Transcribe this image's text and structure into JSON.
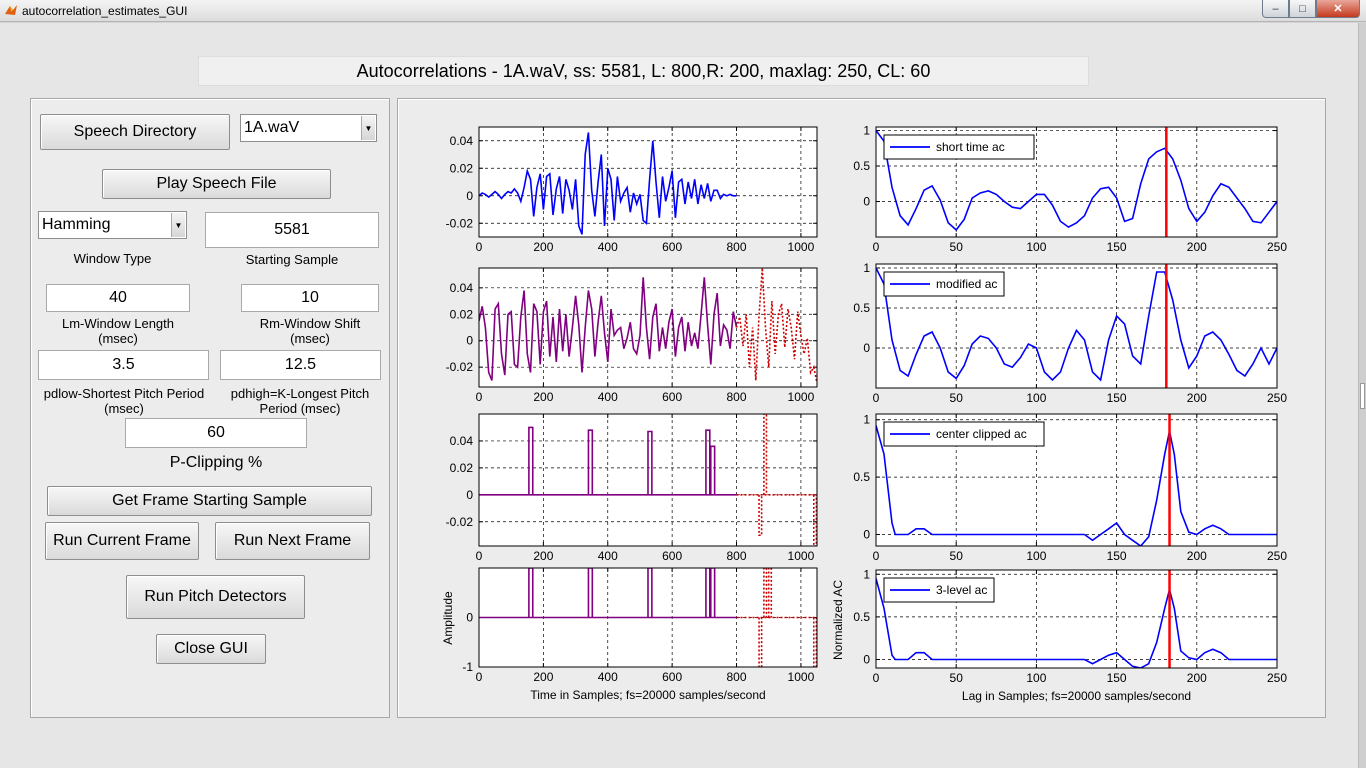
{
  "window": {
    "title": "autocorrelation_estimates_GUI",
    "minimize": "–",
    "maximize": "□",
    "close": "✕"
  },
  "heading": "Autocorrelations - 1A.waV, ss: 5581, L: 800,R: 200, maxlag: 250, CL: 60",
  "controls": {
    "speech_directory": "Speech Directory",
    "file_select": "1A.waV",
    "play_speech": "Play Speech File",
    "window_type_value": "Hamming",
    "window_type_label": "Window Type",
    "starting_sample_value": "5581",
    "starting_sample_label": "Starting Sample",
    "lm_value": "40",
    "lm_label_1": "Lm-Window Length",
    "lm_label_2": "(msec)",
    "rm_value": "10",
    "rm_label_1": "Rm-Window Shift",
    "rm_label_2": "(msec)",
    "pdlow_value": "3.5",
    "pdlow_label_1": "pdlow-Shortest Pitch Period",
    "pdlow_label_2": "(msec)",
    "pdhigh_value": "12.5",
    "pdhigh_label_1": "pdhigh=K-Longest Pitch",
    "pdhigh_label_2": "Period (msec)",
    "pclip_value": "60",
    "pclip_label": "P-Clipping %",
    "get_frame": "Get Frame Starting Sample",
    "run_current": "Run Current Frame",
    "run_next": "Run Next Frame",
    "run_pitch": "Run Pitch Detectors",
    "close_gui": "Close GUI"
  },
  "colors": {
    "signal": "#0000ff",
    "overlay": "#cc0000",
    "clipped": "#800080",
    "pitch_marker": "#ff0000"
  },
  "chart_data": [
    {
      "type": "line",
      "x_ticks": [
        0,
        200,
        400,
        600,
        800,
        1000
      ],
      "xlim": [
        0,
        1050
      ],
      "y_ticks": [
        -0.02,
        0,
        0.02,
        0.04
      ],
      "y_tick_labels": [
        "-0.02",
        "0",
        "0.02",
        "0.04"
      ],
      "ylim": [
        -0.03,
        0.05
      ],
      "grid": true,
      "series": [
        {
          "kind": "speech",
          "x": [
            0,
            10,
            20,
            30,
            40,
            50,
            60,
            70,
            80,
            90,
            100,
            110,
            120,
            130,
            140,
            150,
            160,
            170,
            180,
            190,
            200,
            210,
            220,
            230,
            240,
            250,
            260,
            270,
            280,
            290,
            300,
            310,
            320,
            330,
            340,
            350,
            360,
            370,
            380,
            390,
            400,
            410,
            420,
            430,
            440,
            450,
            460,
            470,
            480,
            490,
            500,
            510,
            520,
            530,
            540,
            550,
            560,
            570,
            580,
            590,
            600,
            610,
            620,
            630,
            640,
            650,
            660,
            670,
            680,
            690,
            700,
            710,
            720,
            730,
            740,
            750,
            760,
            770,
            780,
            790,
            800
          ],
          "y": [
            0,
            0.002,
            0.001,
            -0.001,
            0.001,
            0.003,
            0.001,
            -0.002,
            0.001,
            0.003,
            0.002,
            0.005,
            0.002,
            -0.004,
            0.006,
            0.018,
            0.012,
            -0.015,
            0.006,
            0.016,
            -0.01,
            0.014,
            0.016,
            -0.014,
            0.005,
            0.014,
            -0.013,
            0.012,
            0.004,
            -0.01,
            0.012,
            -0.022,
            -0.028,
            0.03,
            0.046,
            0.004,
            -0.015,
            0.01,
            0.03,
            -0.022,
            0.02,
            0.012,
            -0.018,
            0.014,
            -0.004,
            0.002,
            0.006,
            -0.012,
            0.002,
            -0.006,
            0.001,
            -0.018,
            -0.02,
            0.012,
            0.04,
            0.01,
            -0.016,
            0.014,
            -0.004,
            0.006,
            0.018,
            -0.016,
            0.01,
            0.012,
            -0.006,
            0.01,
            -0.002,
            0.012,
            -0.006,
            0.008,
            -0.002,
            0.009,
            -0.004,
            0.004,
            0.004,
            -0.002,
            0.001,
            0,
            0.001,
            0,
            0
          ]
        }
      ]
    },
    {
      "type": "line",
      "x_ticks": [
        0,
        200,
        400,
        600,
        800,
        1000
      ],
      "xlim": [
        0,
        1050
      ],
      "y_ticks": [
        -0.02,
        0,
        0.02,
        0.04
      ],
      "y_tick_labels": [
        "-0.02",
        "0",
        "0.02",
        "0.04"
      ],
      "ylim": [
        -0.035,
        0.055
      ],
      "grid": true,
      "series": [
        {
          "kind": "clipped_window",
          "x": [
            0,
            10,
            20,
            30,
            40,
            50,
            60,
            70,
            80,
            90,
            100,
            110,
            120,
            130,
            140,
            150,
            160,
            170,
            180,
            190,
            200,
            210,
            220,
            230,
            240,
            250,
            260,
            270,
            280,
            290,
            300,
            310,
            320,
            330,
            340,
            350,
            360,
            370,
            380,
            390,
            400,
            410,
            420,
            430,
            440,
            450,
            460,
            470,
            480,
            490,
            500,
            510,
            520,
            530,
            540,
            550,
            560,
            570,
            580,
            590,
            600,
            610,
            620,
            630,
            640,
            650,
            660,
            670,
            680,
            690,
            700,
            710,
            720,
            730,
            740,
            750,
            760,
            770,
            780,
            790,
            800
          ],
          "y": [
            0.015,
            0.026,
            0.01,
            -0.024,
            -0.03,
            0.024,
            0.028,
            -0.01,
            -0.026,
            0.02,
            0.022,
            -0.018,
            -0.02,
            0.018,
            0.038,
            -0.01,
            -0.024,
            0.028,
            0.022,
            -0.018,
            0.022,
            0.03,
            -0.012,
            0.018,
            -0.016,
            0.024,
            -0.008,
            0.02,
            -0.012,
            0.01,
            0.034,
            0.012,
            -0.024,
            0.01,
            0.038,
            0.024,
            -0.012,
            0.014,
            0.034,
            0.006,
            -0.016,
            0.024,
            0.004,
            0.008,
            0.01,
            -0.006,
            0.002,
            0.014,
            -0.006,
            -0.01,
            0.004,
            0.048,
            0.01,
            -0.014,
            0.018,
            0.028,
            -0.008,
            0.01,
            -0.006,
            0.014,
            0.024,
            -0.012,
            0.01,
            0.018,
            -0.008,
            0.014,
            -0.004,
            0.006,
            -0.006,
            0.02,
            0.048,
            0.012,
            -0.018,
            0.02,
            0.036,
            -0.004,
            0.012,
            0.008,
            -0.006,
            0.022,
            0.01
          ]
        },
        {
          "kind": "lookahead",
          "x": [
            800,
            810,
            820,
            830,
            840,
            850,
            860,
            870,
            880,
            890,
            900,
            910,
            920,
            930,
            940,
            950,
            960,
            970,
            980,
            990,
            1000,
            1010,
            1020,
            1030,
            1040,
            1050
          ],
          "y": [
            0.01,
            0.018,
            -0.004,
            0.02,
            -0.02,
            0.01,
            -0.03,
            0.02,
            0.055,
            0.01,
            -0.02,
            0.03,
            -0.01,
            0.02,
            0.028,
            -0.005,
            0.024,
            0.01,
            -0.014,
            0.022,
            0.004,
            -0.01,
            0.002,
            -0.024,
            -0.02,
            -0.032
          ]
        }
      ]
    },
    {
      "type": "line",
      "x_ticks": [
        0,
        200,
        400,
        600,
        800,
        1000
      ],
      "xlim": [
        0,
        1050
      ],
      "y_ticks": [
        -0.02,
        0,
        0.02,
        0.04
      ],
      "y_tick_labels": [
        "-0.02",
        "0",
        "0.02",
        "0.04"
      ],
      "ylim": [
        -0.038,
        0.06
      ],
      "grid": true,
      "pulses": [
        {
          "x": 155,
          "h": 0.05
        },
        {
          "x": 340,
          "h": 0.048
        },
        {
          "x": 525,
          "h": 0.047
        },
        {
          "x": 705,
          "h": 0.048
        },
        {
          "x": 720,
          "h": 0.036
        }
      ],
      "lookahead_pulses": [
        {
          "x": 870,
          "h": -0.03
        },
        {
          "x": 885,
          "h": 0.06
        },
        {
          "x": 1040,
          "h": -0.038
        }
      ]
    },
    {
      "type": "line",
      "ylabel": "Amplitude",
      "xlabel": "Time in Samples; fs=20000 samples/second",
      "x_ticks": [
        0,
        200,
        400,
        600,
        800,
        1000
      ],
      "xlim": [
        0,
        1050
      ],
      "y_ticks": [
        -1,
        0
      ],
      "y_tick_labels": [
        "-1",
        "0"
      ],
      "ylim": [
        -1,
        1
      ],
      "grid": true,
      "pulses": [
        {
          "x": 155,
          "h": 1
        },
        {
          "x": 340,
          "h": 1
        },
        {
          "x": 525,
          "h": 1
        },
        {
          "x": 705,
          "h": 1
        },
        {
          "x": 720,
          "h": 1
        }
      ],
      "lookahead_pulses": [
        {
          "x": 870,
          "h": -1
        },
        {
          "x": 885,
          "h": 1
        },
        {
          "x": 900,
          "h": 1
        },
        {
          "x": 1040,
          "h": -1
        }
      ]
    },
    {
      "type": "line",
      "x_ticks": [
        0,
        50,
        100,
        150,
        200,
        250
      ],
      "xlim": [
        0,
        250
      ],
      "y_ticks": [
        0,
        0.5,
        1
      ],
      "y_tick_labels": [
        "0",
        "0.5",
        "1"
      ],
      "ylim": [
        -0.5,
        1.05
      ],
      "grid": true,
      "legend": "short time ac",
      "pitch_lag": 181,
      "series": [
        {
          "x": [
            0,
            5,
            10,
            15,
            20,
            25,
            30,
            35,
            40,
            45,
            50,
            55,
            60,
            65,
            70,
            75,
            80,
            85,
            90,
            95,
            100,
            105,
            110,
            115,
            120,
            125,
            130,
            135,
            140,
            145,
            150,
            155,
            160,
            165,
            170,
            175,
            180,
            185,
            190,
            195,
            200,
            205,
            210,
            215,
            220,
            225,
            230,
            235,
            240,
            245,
            250
          ],
          "y": [
            1,
            0.85,
            0.2,
            -0.2,
            -0.33,
            -0.1,
            0.16,
            0.22,
            0.02,
            -0.3,
            -0.4,
            -0.25,
            0.05,
            0.12,
            0.15,
            0.1,
            0.0,
            -0.08,
            -0.1,
            0.0,
            0.1,
            0.1,
            -0.05,
            -0.28,
            -0.36,
            -0.3,
            -0.2,
            0.05,
            0.18,
            0.2,
            0.05,
            -0.28,
            -0.24,
            0.25,
            0.6,
            0.7,
            0.75,
            0.6,
            0.3,
            -0.1,
            -0.28,
            -0.15,
            0.08,
            0.25,
            0.2,
            0.05,
            -0.1,
            -0.28,
            -0.3,
            -0.15,
            0.0
          ]
        }
      ]
    },
    {
      "type": "line",
      "x_ticks": [
        0,
        50,
        100,
        150,
        200,
        250
      ],
      "xlim": [
        0,
        250
      ],
      "y_ticks": [
        0,
        0.5,
        1
      ],
      "y_tick_labels": [
        "0",
        "0.5",
        "1"
      ],
      "ylim": [
        -0.5,
        1.05
      ],
      "grid": true,
      "legend": "modified ac",
      "pitch_lag": 181,
      "series": [
        {
          "x": [
            0,
            5,
            10,
            15,
            20,
            25,
            30,
            35,
            40,
            45,
            50,
            55,
            60,
            65,
            70,
            75,
            80,
            85,
            90,
            95,
            100,
            105,
            110,
            115,
            120,
            125,
            130,
            135,
            140,
            145,
            150,
            155,
            160,
            165,
            170,
            175,
            180,
            185,
            190,
            195,
            200,
            205,
            210,
            215,
            220,
            225,
            230,
            235,
            240,
            245,
            250
          ],
          "y": [
            1,
            0.8,
            0.1,
            -0.28,
            -0.35,
            -0.08,
            0.15,
            0.2,
            0.0,
            -0.3,
            -0.38,
            -0.22,
            0.05,
            0.15,
            0.12,
            0.0,
            -0.2,
            -0.24,
            -0.12,
            0.05,
            0.0,
            -0.3,
            -0.4,
            -0.3,
            0.0,
            0.22,
            0.1,
            -0.3,
            -0.4,
            0.1,
            0.4,
            0.3,
            -0.1,
            -0.2,
            0.4,
            0.95,
            0.95,
            0.6,
            0.1,
            -0.25,
            -0.1,
            0.15,
            0.2,
            0.1,
            -0.08,
            -0.28,
            -0.35,
            -0.2,
            0.0,
            -0.2,
            0.0
          ]
        }
      ]
    },
    {
      "type": "line",
      "x_ticks": [
        0,
        50,
        100,
        150,
        200,
        250
      ],
      "xlim": [
        0,
        250
      ],
      "y_ticks": [
        0,
        0.5,
        1
      ],
      "y_tick_labels": [
        "0",
        "0.5",
        "1"
      ],
      "ylim": [
        -0.1,
        1.05
      ],
      "grid": true,
      "legend": "center clipped ac",
      "pitch_lag": 183,
      "series": [
        {
          "x": [
            0,
            5,
            10,
            12,
            15,
            20,
            25,
            30,
            35,
            40,
            50,
            60,
            70,
            80,
            90,
            100,
            110,
            120,
            130,
            135,
            140,
            145,
            150,
            155,
            160,
            165,
            170,
            175,
            180,
            183,
            186,
            190,
            195,
            200,
            205,
            210,
            215,
            220,
            230,
            240,
            250
          ],
          "y": [
            0.95,
            0.7,
            0.1,
            0.0,
            0.0,
            0.0,
            0.05,
            0.05,
            0.0,
            0.0,
            0.0,
            0.0,
            0.0,
            0.0,
            0.0,
            0.0,
            0.0,
            0.0,
            0.0,
            -0.05,
            0.0,
            0.05,
            0.1,
            0.0,
            -0.05,
            -0.1,
            -0.02,
            0.3,
            0.7,
            0.9,
            0.7,
            0.2,
            0.02,
            0.0,
            0.05,
            0.08,
            0.05,
            0.0,
            0.0,
            0.0,
            0.0
          ]
        }
      ]
    },
    {
      "type": "line",
      "ylabel": "Normalized AC",
      "xlabel": "Lag in Samples; fs=20000 samples/second",
      "x_ticks": [
        0,
        50,
        100,
        150,
        200,
        250
      ],
      "xlim": [
        0,
        250
      ],
      "y_ticks": [
        0,
        0.5,
        1
      ],
      "y_tick_labels": [
        "0",
        "0.5",
        "1"
      ],
      "ylim": [
        -0.1,
        1.05
      ],
      "grid": true,
      "legend": "3-level ac",
      "pitch_lag": 183,
      "series": [
        {
          "x": [
            0,
            5,
            10,
            12,
            15,
            20,
            25,
            30,
            35,
            40,
            50,
            60,
            70,
            80,
            90,
            100,
            110,
            120,
            130,
            135,
            140,
            145,
            150,
            155,
            160,
            165,
            170,
            175,
            180,
            183,
            186,
            190,
            195,
            200,
            205,
            210,
            215,
            220,
            230,
            240,
            250
          ],
          "y": [
            0.95,
            0.6,
            0.05,
            0.0,
            0.0,
            0.0,
            0.08,
            0.08,
            0.0,
            0.0,
            0.0,
            0.0,
            0.0,
            0.0,
            0.0,
            0.0,
            0.0,
            0.0,
            0.0,
            -0.05,
            0.0,
            0.05,
            0.08,
            0.0,
            -0.08,
            -0.1,
            -0.05,
            0.2,
            0.6,
            0.82,
            0.6,
            0.1,
            0.02,
            0.0,
            0.08,
            0.12,
            0.08,
            0.0,
            0.0,
            0.0,
            0.0
          ]
        }
      ]
    }
  ]
}
